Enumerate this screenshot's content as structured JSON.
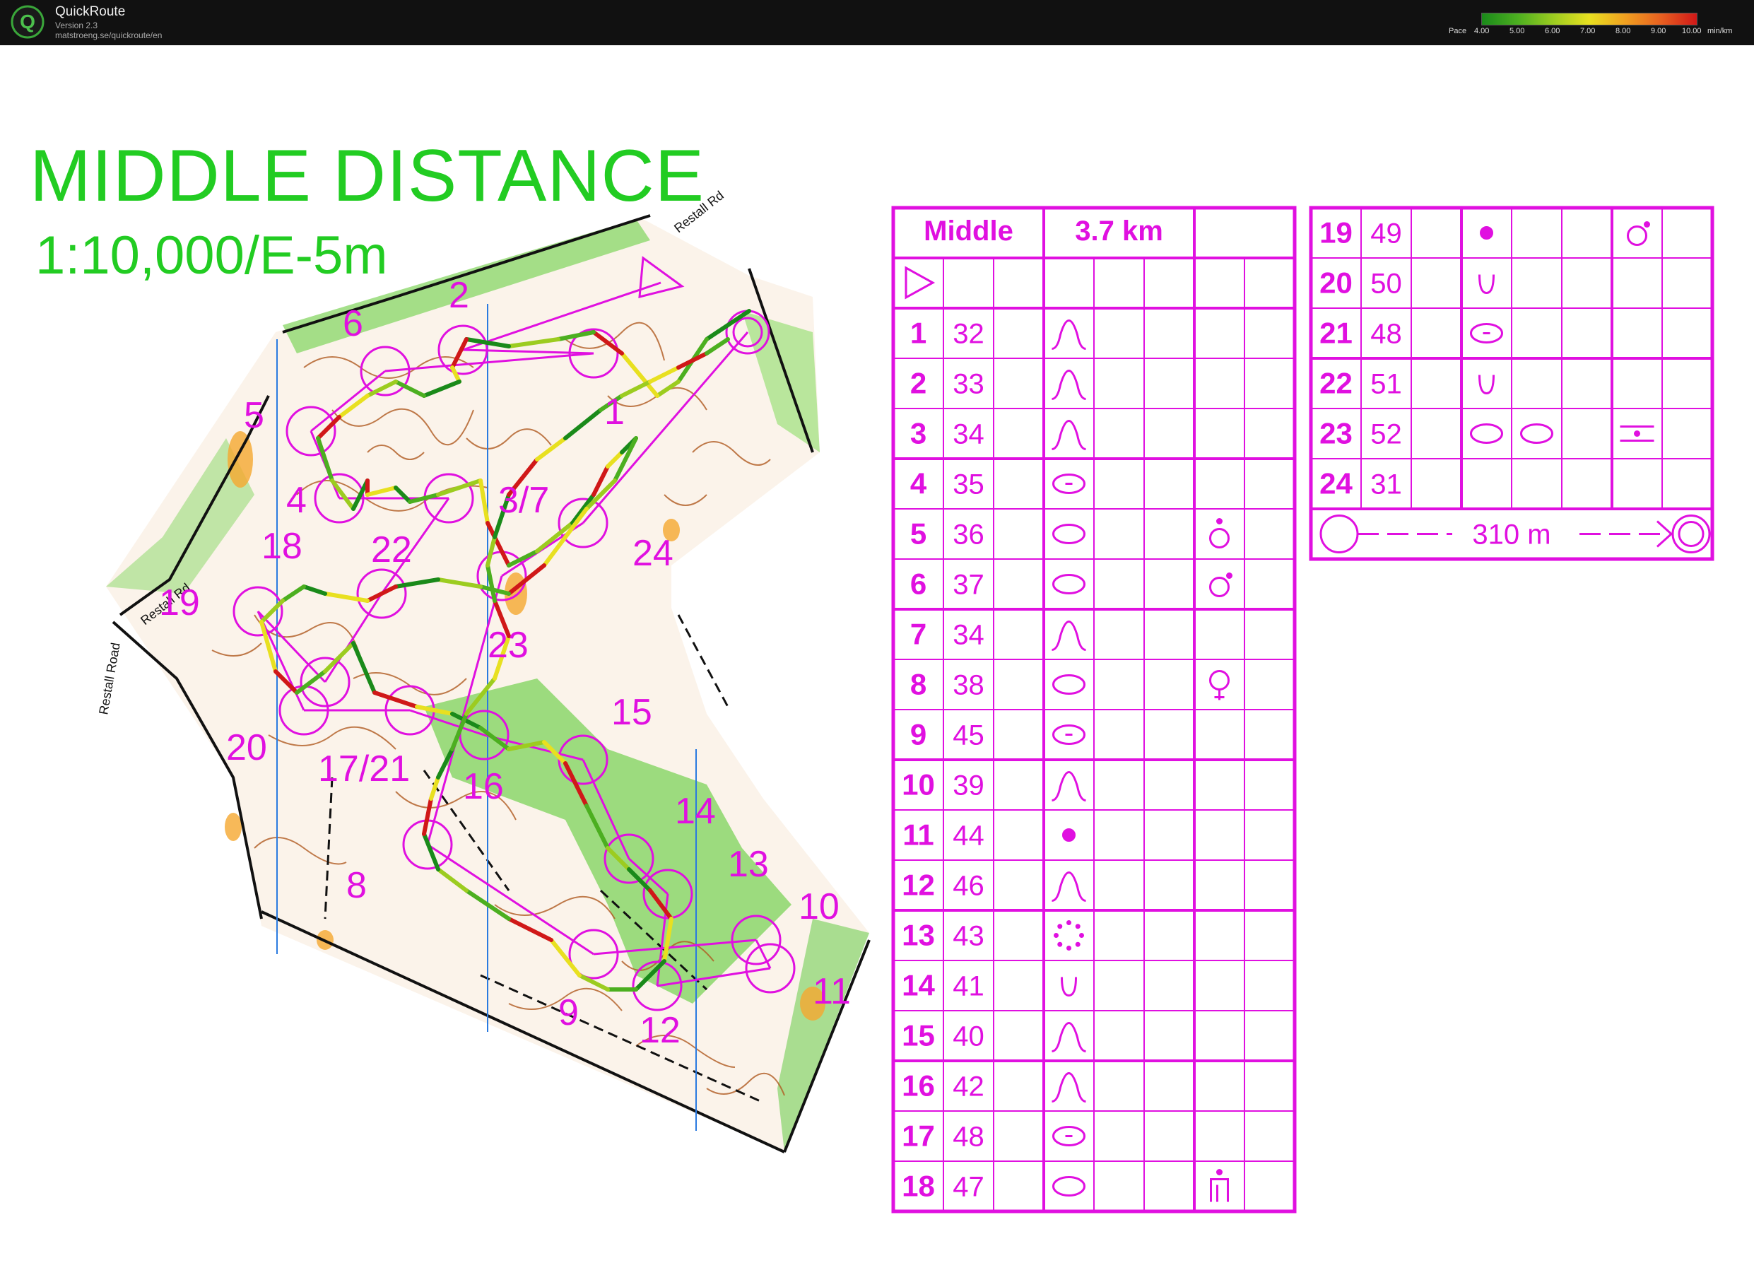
{
  "app": {
    "title": "QuickRoute",
    "version": "Version 2.3",
    "url": "matstroeng.se/quickroute/en",
    "logo_letter": "Q"
  },
  "pace_legend": {
    "label": "Pace",
    "ticks": [
      "4.00",
      "5.00",
      "6.00",
      "7.00",
      "8.00",
      "9.00",
      "10.00"
    ],
    "unit": "min/km",
    "gradient_colors": [
      "#1a8a1a",
      "#4caf20",
      "#9ccc20",
      "#e8e020",
      "#f0a020",
      "#e86020",
      "#d01818"
    ]
  },
  "map": {
    "title": "MIDDLE DISTANCE",
    "scale": "1:10,000/E-5m",
    "road_labels": [
      "Restall Rd",
      "Restall Rd",
      "Restall Road"
    ],
    "control_labels": [
      "1",
      "2",
      "3/7",
      "4",
      "5",
      "6",
      "8",
      "9",
      "10",
      "11",
      "12",
      "13",
      "14",
      "15",
      "16",
      "17/21",
      "18",
      "19",
      "20",
      "22",
      "23",
      "24"
    ],
    "colors": {
      "course": "#e010e0",
      "title": "#22cc22",
      "contour": "#b05a20",
      "vegetation": "#86d36a",
      "open": "#f5a830"
    }
  },
  "description_sheet": {
    "header": {
      "event": "Middle",
      "length": "3.7 km"
    },
    "start_symbol": "start-triangle-icon",
    "rows": [
      {
        "num": "1",
        "code": "32",
        "feature": "knoll-icon",
        "detail": ""
      },
      {
        "num": "2",
        "code": "33",
        "feature": "knoll-icon",
        "detail": ""
      },
      {
        "num": "3",
        "code": "34",
        "feature": "knoll-icon",
        "detail": ""
      },
      {
        "num": "4",
        "code": "35",
        "feature": "small-knoll-icon",
        "detail": ""
      },
      {
        "num": "5",
        "code": "36",
        "feature": "elongated-knoll-icon",
        "detail": "foot-icon"
      },
      {
        "num": "6",
        "code": "37",
        "feature": "elongated-knoll-icon",
        "detail": "north-east-foot-icon"
      },
      {
        "num": "7",
        "code": "34",
        "feature": "knoll-icon",
        "detail": ""
      },
      {
        "num": "8",
        "code": "38",
        "feature": "elongated-knoll-icon",
        "detail": "top-icon"
      },
      {
        "num": "9",
        "code": "45",
        "feature": "small-knoll-icon",
        "detail": ""
      },
      {
        "num": "10",
        "code": "39",
        "feature": "knoll-icon",
        "detail": ""
      },
      {
        "num": "11",
        "code": "44",
        "feature": "dot-knoll-icon",
        "detail": ""
      },
      {
        "num": "12",
        "code": "46",
        "feature": "knoll-icon",
        "detail": ""
      },
      {
        "num": "13",
        "code": "43",
        "feature": "dotted-depression-icon",
        "detail": ""
      },
      {
        "num": "14",
        "code": "41",
        "feature": "small-depression-icon",
        "detail": ""
      },
      {
        "num": "15",
        "code": "40",
        "feature": "knoll-icon",
        "detail": ""
      },
      {
        "num": "16",
        "code": "42",
        "feature": "knoll-icon",
        "detail": ""
      },
      {
        "num": "17",
        "code": "48",
        "feature": "small-knoll-icon",
        "detail": ""
      },
      {
        "num": "18",
        "code": "47",
        "feature": "elongated-knoll-icon",
        "detail": "top-edge-icon"
      }
    ],
    "rows_right": [
      {
        "num": "19",
        "code": "49",
        "feature": "dot-knoll-icon",
        "detail": "north-east-foot-icon",
        "extra": ""
      },
      {
        "num": "20",
        "code": "50",
        "feature": "small-depression-icon",
        "detail": "",
        "extra": ""
      },
      {
        "num": "21",
        "code": "48",
        "feature": "small-knoll-icon",
        "detail": "",
        "extra": ""
      },
      {
        "num": "22",
        "code": "51",
        "feature": "small-depression-icon",
        "detail": "",
        "extra": ""
      },
      {
        "num": "23",
        "code": "52",
        "feature": "elongated-knoll-icon",
        "detail": "between-icon",
        "extra": "elongated-knoll-icon"
      },
      {
        "num": "24",
        "code": "31",
        "feature": "",
        "detail": "",
        "extra": ""
      }
    ],
    "finish": {
      "distance": "310 m"
    }
  }
}
